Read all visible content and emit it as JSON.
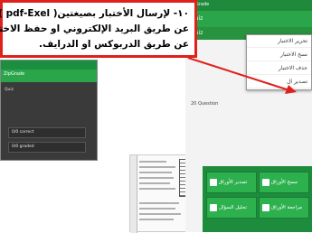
{
  "callout": {
    "line1": "١٠- لإرسال الأختبار بصيغتين( pdf-Exel )",
    "line2": "عن طريق البريد الإلكتروني او حفظ الاختبار",
    "line3": "عن طريق الدربوكس او الدرايف."
  },
  "left_phone": {
    "header": "ZipGrade",
    "lines": [
      "Quiz",
      "",
      "",
      ""
    ],
    "box1": "0/0 correct",
    "box2": "0/0 graded"
  },
  "right_phone": {
    "status": "ZipGrade",
    "title": "Quiz",
    "tab": "Quiz",
    "info_lines": [
      "20 Question",
      "",
      "",
      "",
      ""
    ],
    "menu_items": [
      "تحرير الاختبار",
      "نسخ الاختبار",
      "حذف الاختبار",
      "تصدير ال"
    ],
    "buttons": [
      "تصدير الأوراق",
      "مسح الأوراق",
      "تحليل السؤال",
      "مراجعة الأوراق"
    ]
  },
  "colors": {
    "callout_border": "#e0201b",
    "arrow": "#e0201b",
    "app_green": "#2aa54a"
  }
}
